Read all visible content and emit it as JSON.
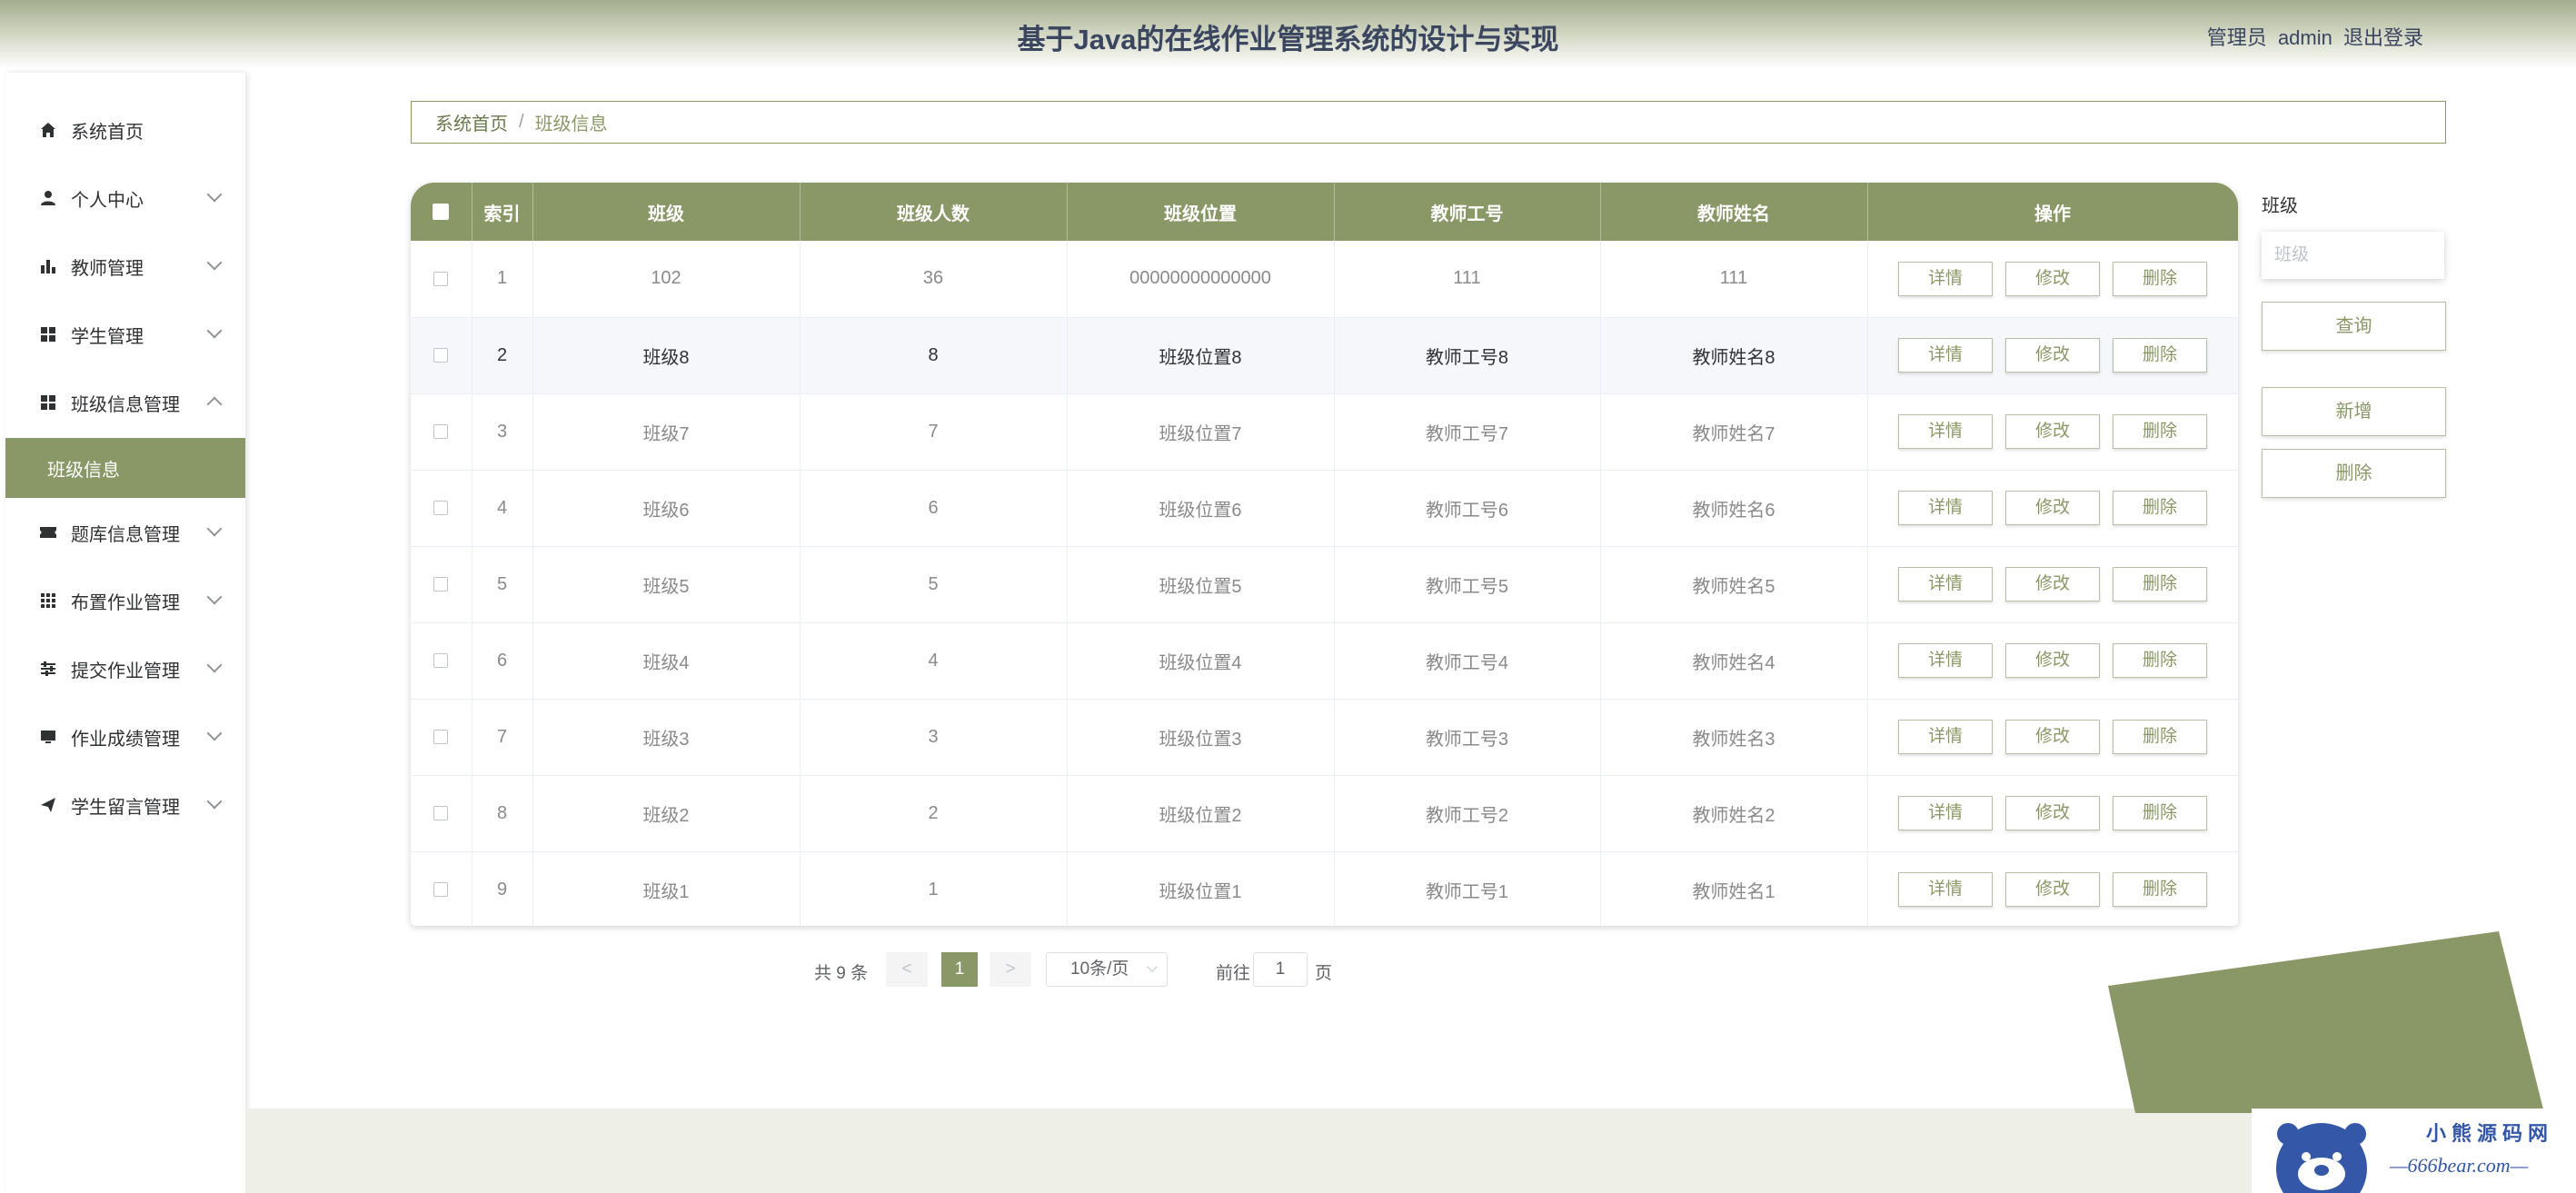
{
  "header": {
    "title": "基于Java的在线作业管理系统的设计与实现",
    "role": "管理员",
    "username": "admin",
    "logout_label": "退出登录"
  },
  "sidebar": {
    "items": [
      {
        "label": "系统首页",
        "icon": "home-icon"
      },
      {
        "label": "个人中心",
        "icon": "user-icon"
      },
      {
        "label": "教师管理",
        "icon": "bar-chart-icon"
      },
      {
        "label": "学生管理",
        "icon": "grid-icon"
      },
      {
        "label": "班级信息管理",
        "icon": "grid-icon"
      },
      {
        "label": "题库信息管理",
        "icon": "ticket-icon"
      },
      {
        "label": "布置作业管理",
        "icon": "dots-grid-icon"
      },
      {
        "label": "提交作业管理",
        "icon": "sliders-icon"
      },
      {
        "label": "作业成绩管理",
        "icon": "monitor-icon"
      },
      {
        "label": "学生留言管理",
        "icon": "send-icon"
      }
    ],
    "active_sub": "班级信息"
  },
  "breadcrumb": {
    "home": "系统首页",
    "separator": "/",
    "current": "班级信息"
  },
  "table": {
    "headers": [
      "索引",
      "班级",
      "班级人数",
      "班级位置",
      "教师工号",
      "教师姓名",
      "操作"
    ],
    "rows": [
      {
        "index": "1",
        "cls": "102",
        "count": "36",
        "location": "00000000000000",
        "tid": "111",
        "tname": "111"
      },
      {
        "index": "2",
        "cls": "班级8",
        "count": "8",
        "location": "班级位置8",
        "tid": "教师工号8",
        "tname": "教师姓名8"
      },
      {
        "index": "3",
        "cls": "班级7",
        "count": "7",
        "location": "班级位置7",
        "tid": "教师工号7",
        "tname": "教师姓名7"
      },
      {
        "index": "4",
        "cls": "班级6",
        "count": "6",
        "location": "班级位置6",
        "tid": "教师工号6",
        "tname": "教师姓名6"
      },
      {
        "index": "5",
        "cls": "班级5",
        "count": "5",
        "location": "班级位置5",
        "tid": "教师工号5",
        "tname": "教师姓名5"
      },
      {
        "index": "6",
        "cls": "班级4",
        "count": "4",
        "location": "班级位置4",
        "tid": "教师工号4",
        "tname": "教师姓名4"
      },
      {
        "index": "7",
        "cls": "班级3",
        "count": "3",
        "location": "班级位置3",
        "tid": "教师工号3",
        "tname": "教师姓名3"
      },
      {
        "index": "8",
        "cls": "班级2",
        "count": "2",
        "location": "班级位置2",
        "tid": "教师工号2",
        "tname": "教师姓名2"
      },
      {
        "index": "9",
        "cls": "班级1",
        "count": "1",
        "location": "班级位置1",
        "tid": "教师工号1",
        "tname": "教师姓名1"
      }
    ],
    "actions": {
      "detail": "详情",
      "edit": "修改",
      "delete": "删除"
    }
  },
  "pagination": {
    "total": "共 9 条",
    "prev": "<",
    "next": ">",
    "current_page": "1",
    "page_size": "10条/页",
    "goto_label": "前往",
    "goto_value": "1",
    "page_unit": "页"
  },
  "search": {
    "label": "班级",
    "placeholder": "班级",
    "query_label": "查询",
    "add_label": "新增",
    "delete_label": "删除"
  },
  "watermark": {
    "cn": "小熊源码网",
    "en": "—666bear.com—"
  },
  "colors": {
    "accent": "#8a9766",
    "title": "#3a4560"
  }
}
